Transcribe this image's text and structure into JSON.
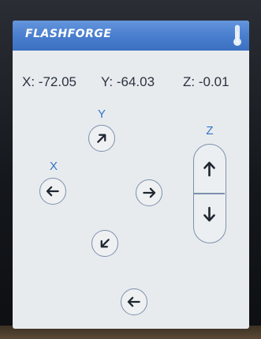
{
  "header": {
    "brand": "FLASHFORGE",
    "status_icon": "thermometer-icon"
  },
  "position": {
    "x": "X: -72.05",
    "y": "Y: -64.03",
    "z": "Z: -0.01"
  },
  "axes": {
    "x_label": "X",
    "y_label": "Y",
    "z_label": "Z"
  },
  "controls": {
    "y_plus_icon": "arrow-up-right-icon",
    "y_minus_icon": "arrow-down-left-icon",
    "x_minus_icon": "arrow-left-icon",
    "x_plus_icon": "arrow-right-icon",
    "z_up_icon": "arrow-up-icon",
    "z_down_icon": "arrow-down-icon",
    "back_icon": "back-arrow-icon"
  },
  "colors": {
    "header_blue": "#4a7fcf",
    "accent_blue": "#2f74c9",
    "screen_bg": "#e8ebee"
  }
}
